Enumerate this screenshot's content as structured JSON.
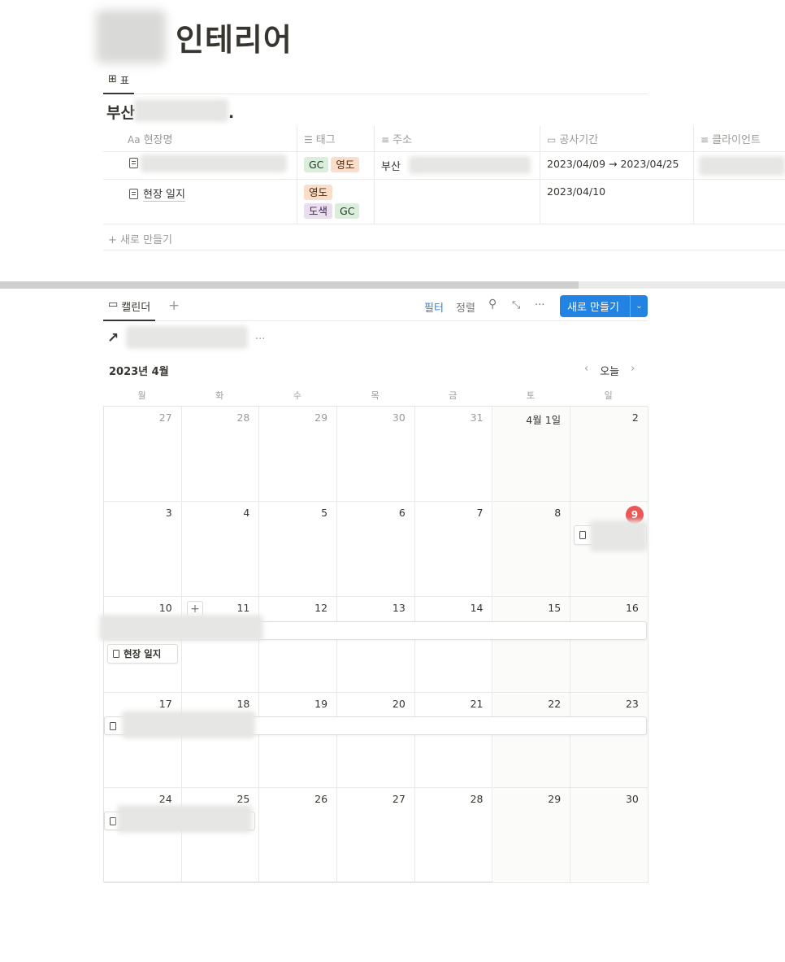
{
  "page": {
    "title": "인테리어"
  },
  "table_view": {
    "tab_icon": "table-icon",
    "tab_label": "표",
    "db_title": "부산",
    "db_title_suffix": ".",
    "columns": [
      {
        "icon": "Aa",
        "label": "현장명"
      },
      {
        "icon": "☰",
        "label": "태그"
      },
      {
        "icon": "≡",
        "label": "주소"
      },
      {
        "icon": "calendar-icon",
        "label": "공사기간"
      },
      {
        "icon": "≡",
        "label": "클라이언트"
      }
    ],
    "rows": [
      {
        "name": "",
        "tags": [
          "GC",
          "영도"
        ],
        "address": "부산",
        "period": "2023/04/09 → 2023/04/25"
      },
      {
        "name": "현장 일지",
        "tags": [
          "영도",
          "도색",
          "GC"
        ],
        "address": "",
        "period": "2023/04/10"
      }
    ],
    "new_row_label": "새로 만들기"
  },
  "calendar_view": {
    "tab_label": "캘린더",
    "add_view_label": "+",
    "toolbar": {
      "filter": "필터",
      "sort": "정렬",
      "more": "···",
      "new_button": "새로 만들기",
      "new_caret": "⌄"
    },
    "month_label": "2023년 4월",
    "nav": {
      "prev": "‹",
      "today": "오늘",
      "next": "›"
    },
    "weekdays": [
      "월",
      "화",
      "수",
      "목",
      "금",
      "토",
      "일"
    ],
    "weeks": [
      [
        "27",
        "28",
        "29",
        "30",
        "31",
        "4월 1일",
        "2"
      ],
      [
        "3",
        "4",
        "5",
        "6",
        "7",
        "8",
        "9"
      ],
      [
        "10",
        "11",
        "12",
        "13",
        "14",
        "15",
        "16"
      ],
      [
        "17",
        "18",
        "19",
        "20",
        "21",
        "22",
        "23"
      ],
      [
        "24",
        "25",
        "26",
        "27",
        "28",
        "29",
        "30"
      ]
    ],
    "today": "9",
    "events": {
      "log_label": "현장 일지"
    }
  }
}
